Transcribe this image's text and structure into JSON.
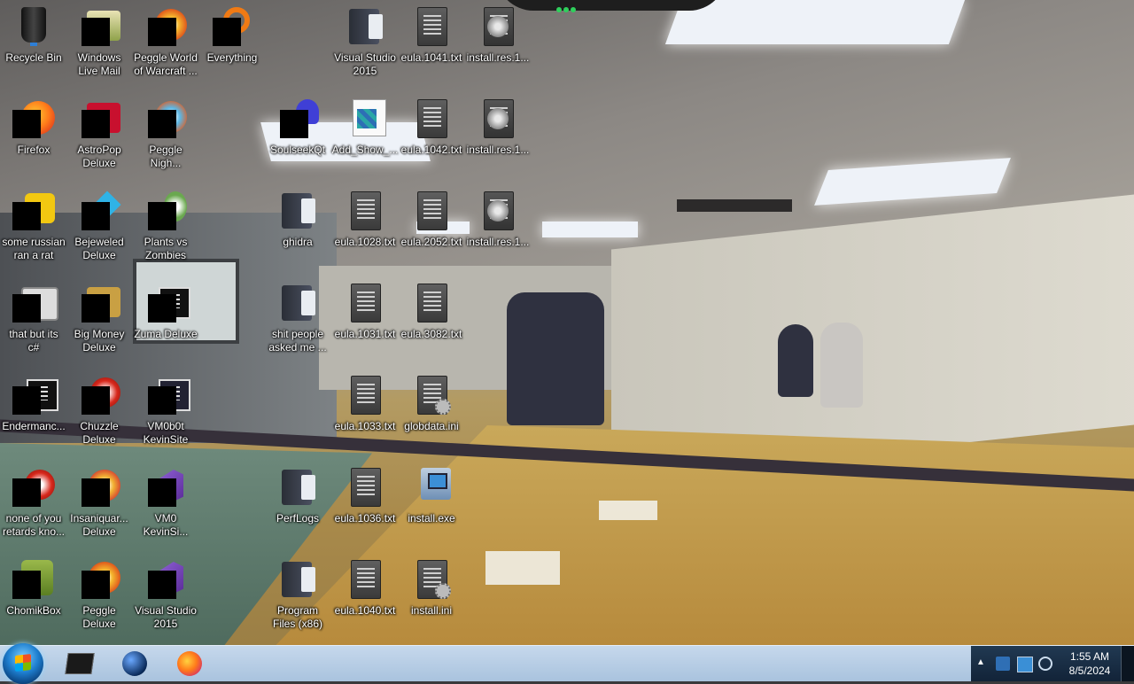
{
  "desktop": {
    "icons": [
      {
        "label": "Recycle Bin",
        "icon": "recycle-bin-icon"
      },
      {
        "label": "Windows\nLive Mail",
        "icon": "mail-icon"
      },
      {
        "label": "Peggle World\nof Warcraft ...",
        "icon": "peggle-icon"
      },
      {
        "label": "Everything",
        "icon": "search-app-icon"
      },
      {
        "label": "Visual Studio\n2015",
        "icon": "folder-icon"
      },
      {
        "label": "eula.1041.txt",
        "icon": "text-file-icon"
      },
      {
        "label": "install.res.1...",
        "icon": "resource-file-icon"
      },
      {
        "label": "Firefox",
        "icon": "firefox-icon"
      },
      {
        "label": "AstroPop\nDeluxe",
        "icon": "game-icon"
      },
      {
        "label": "Peggle\nNigh...",
        "icon": "peggle-icon"
      },
      {
        "label": "SoulseekQt",
        "icon": "soulseek-icon"
      },
      {
        "label": "Add_Show_...",
        "icon": "registry-file-icon"
      },
      {
        "label": "eula.1042.txt",
        "icon": "text-file-icon"
      },
      {
        "label": "install.res.1...",
        "icon": "resource-file-icon"
      },
      {
        "label": "some russian\nran a rat",
        "icon": "pin-icon"
      },
      {
        "label": "Bejeweled\nDeluxe",
        "icon": "gem-icon"
      },
      {
        "label": "Plants vs\nZombies",
        "icon": "plant-icon"
      },
      {
        "label": "ghidra",
        "icon": "folder-icon"
      },
      {
        "label": "eula.1028.txt",
        "icon": "text-file-icon"
      },
      {
        "label": "eula.2052.txt",
        "icon": "text-file-icon"
      },
      {
        "label": "install.res.1...",
        "icon": "resource-file-icon"
      },
      {
        "label": "that but its\nc#",
        "icon": "shortcut-icon"
      },
      {
        "label": "Big Money\nDeluxe",
        "icon": "game-icon"
      },
      {
        "label": "Zuma Deluxe",
        "icon": "console-icon"
      },
      {
        "label": "shit people\nasked me ...",
        "icon": "folder-icon"
      },
      {
        "label": "eula.1031.txt",
        "icon": "text-file-icon"
      },
      {
        "label": "eula.3082.txt",
        "icon": "text-file-icon"
      },
      {
        "label": "Endermanc...",
        "icon": "console-icon"
      },
      {
        "label": "Chuzzle\nDeluxe",
        "icon": "red-swirl-icon"
      },
      {
        "label": "VM0b0t\nKevinSite",
        "icon": "console-icon"
      },
      {
        "label": "eula.1033.txt",
        "icon": "text-file-icon"
      },
      {
        "label": "globdata.ini",
        "icon": "settings-file-icon"
      },
      {
        "label": "none of you\nretards kno...",
        "icon": "red-swirl-icon"
      },
      {
        "label": "Insaniquar...\nDeluxe",
        "icon": "game-icon"
      },
      {
        "label": "VM0\nKevinSi...",
        "icon": "vs-icon"
      },
      {
        "label": "PerfLogs",
        "icon": "folder-icon"
      },
      {
        "label": "eula.1036.txt",
        "icon": "text-file-icon"
      },
      {
        "label": "install.exe",
        "icon": "installer-icon"
      },
      {
        "label": "ChomikBox",
        "icon": "chomikbox-icon"
      },
      {
        "label": "Peggle\nDeluxe",
        "icon": "peggle-icon"
      },
      {
        "label": "Visual Studio\n2015",
        "icon": "vs-icon"
      },
      {
        "label": "Program\nFiles (x86)",
        "icon": "folder-icon"
      },
      {
        "label": "eula.1040.txt",
        "icon": "text-file-icon"
      },
      {
        "label": "install.ini",
        "icon": "settings-file-icon"
      }
    ]
  },
  "taskbar": {
    "start_icon": "windows-start-icon",
    "pinned": [
      {
        "name": "console-app",
        "icon": "console-icon"
      },
      {
        "name": "globe-app",
        "icon": "globe-icon"
      },
      {
        "name": "firefox",
        "icon": "firefox-icon"
      }
    ],
    "tray": {
      "time": "1:55 AM",
      "date": "8/5/2024"
    }
  }
}
